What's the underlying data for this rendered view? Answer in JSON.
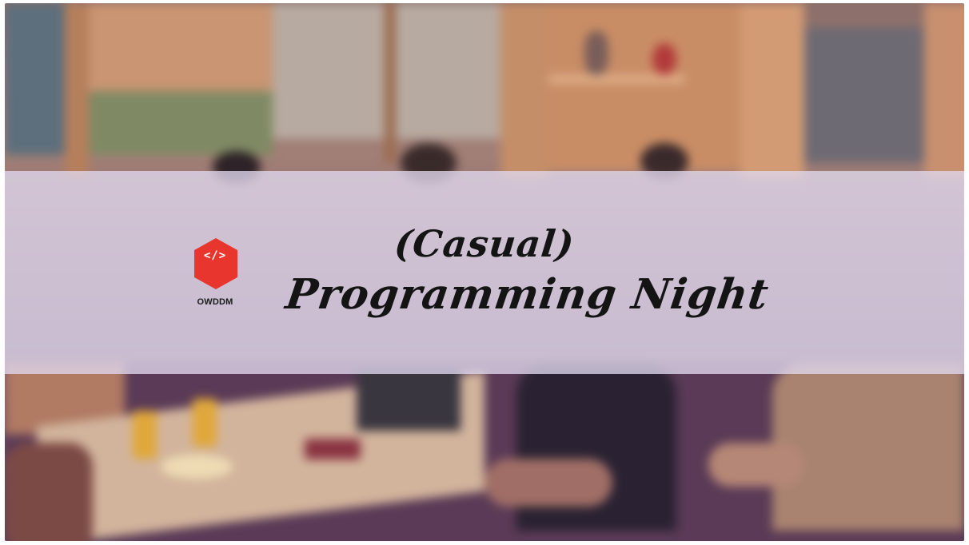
{
  "logo": {
    "code_symbol": "</>",
    "name": "OWDDM",
    "accent_color": "#e8352e"
  },
  "title": {
    "line1": "(Casual)",
    "line2": "Programming Night"
  },
  "colors": {
    "banner_overlay": "#e0d8ee",
    "title_text": "#141414"
  }
}
